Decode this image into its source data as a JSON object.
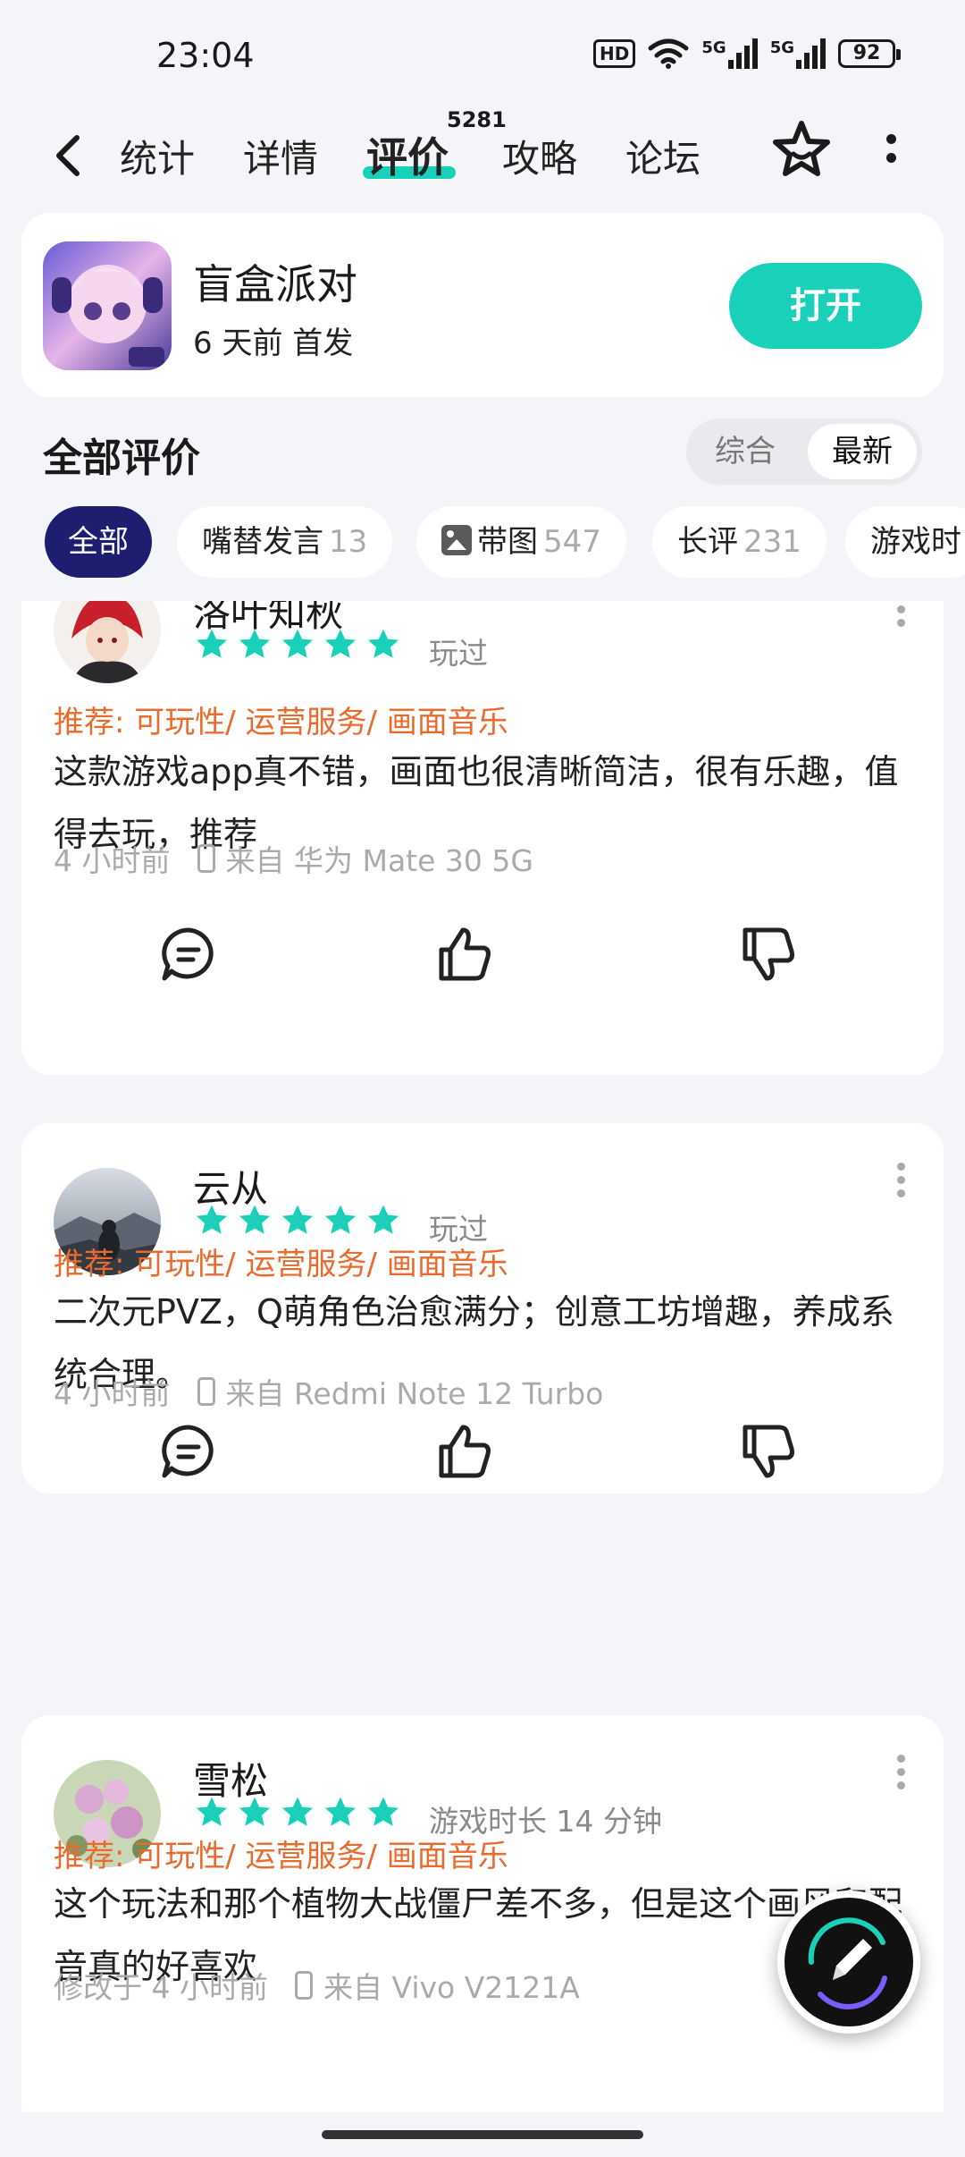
{
  "status_bar": {
    "time": "23:04",
    "hd": "HD",
    "net1": "5G",
    "net2": "5G",
    "battery": "92"
  },
  "nav": {
    "tabs": [
      {
        "label": "统计"
      },
      {
        "label": "详情"
      },
      {
        "label": "评价",
        "count": "5281"
      },
      {
        "label": "攻略"
      },
      {
        "label": "论坛"
      }
    ]
  },
  "game": {
    "name": "盲盒派对",
    "subtitle": "6 天前 首发",
    "open_label": "打开"
  },
  "section": {
    "title": "全部评价",
    "sort_options": [
      "综合",
      "最新"
    ]
  },
  "filters": [
    {
      "label": "全部",
      "count": ""
    },
    {
      "label": "嘴替发言",
      "count": "13"
    },
    {
      "label": "带图",
      "count": "547"
    },
    {
      "label": "长评",
      "count": "231"
    },
    {
      "label": "游戏时",
      "count": ""
    }
  ],
  "reviews": [
    {
      "user": "洛叶知秋",
      "status": "玩过",
      "tags": "推荐: 可玩性/ 运营服务/ 画面音乐",
      "content": "这款游戏app真不错，画面也很清晰简洁，很有乐趣，值得去玩，推荐",
      "time": "4 小时前",
      "device": "来自 华为 Mate 30 5G"
    },
    {
      "user": "云从",
      "status": "玩过",
      "tags": "推荐: 可玩性/ 运营服务/ 画面音乐",
      "content": "二次元PVZ，Q萌角色治愈满分；创意工坊增趣，养成系统合理。",
      "time": "4 小时前",
      "device": "来自 Redmi Note 12 Turbo"
    },
    {
      "user": "雪松",
      "status": "游戏时长 14 分钟",
      "tags": "推荐: 可玩性/ 运营服务/ 画面音乐",
      "content": "这个玩法和那个植物大战僵尸差不多，但是这个画风和配音真的好喜欢",
      "time": "修改于 4 小时前",
      "device": "来自 Vivo V2121A"
    }
  ],
  "colors": {
    "accent": "#19d1b9",
    "tag_orange": "#e86a2c",
    "chip_active": "#1d1e6f"
  }
}
